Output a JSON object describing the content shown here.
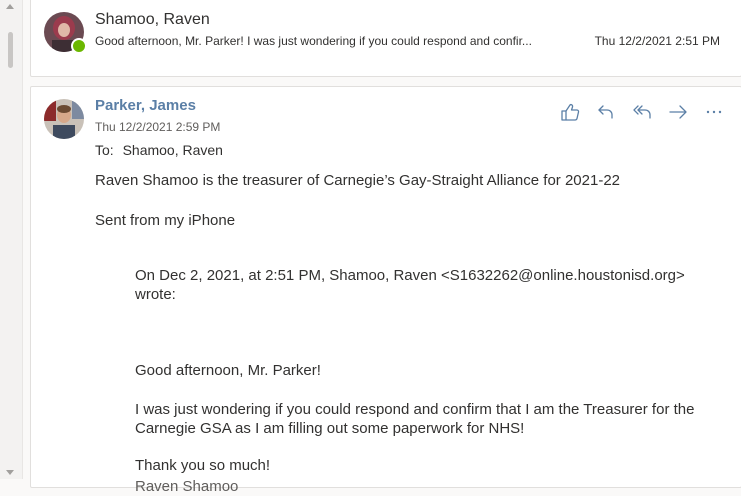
{
  "thread": {
    "collapsed_message": {
      "sender": "Shamoo, Raven",
      "preview": "Good afternoon, Mr. Parker! I was just wondering if you could respond and confir...",
      "datetime": "Thu 12/2/2021 2:51 PM",
      "presence_color": "#6bb700"
    },
    "expanded_message": {
      "sender": "Parker, James",
      "datetime": "Thu 12/2/2021 2:59 PM",
      "to_label": "To:",
      "to_value": "Shamoo, Raven",
      "body_line1": "Raven Shamoo is the treasurer of Carnegie’s Gay-Straight Alliance for 2021-22",
      "body_line2": "Sent from my iPhone",
      "quoted": {
        "header": "On Dec 2, 2021, at 2:51 PM, Shamoo, Raven <S1632262@online.houstonisd.org> wrote:",
        "greeting": "Good afternoon, Mr. Parker!",
        "body": "I was just wondering if you could respond and confirm that I am the Treasurer for the Carnegie GSA as I am filling out some paperwork for NHS!",
        "thanks": "Thank you so much!",
        "signature": "Raven Shamoo"
      },
      "actions": [
        "like-icon",
        "reply-icon",
        "reply-all-icon",
        "forward-icon",
        "more-icon"
      ],
      "accent_color": "#5b7fa6"
    }
  }
}
